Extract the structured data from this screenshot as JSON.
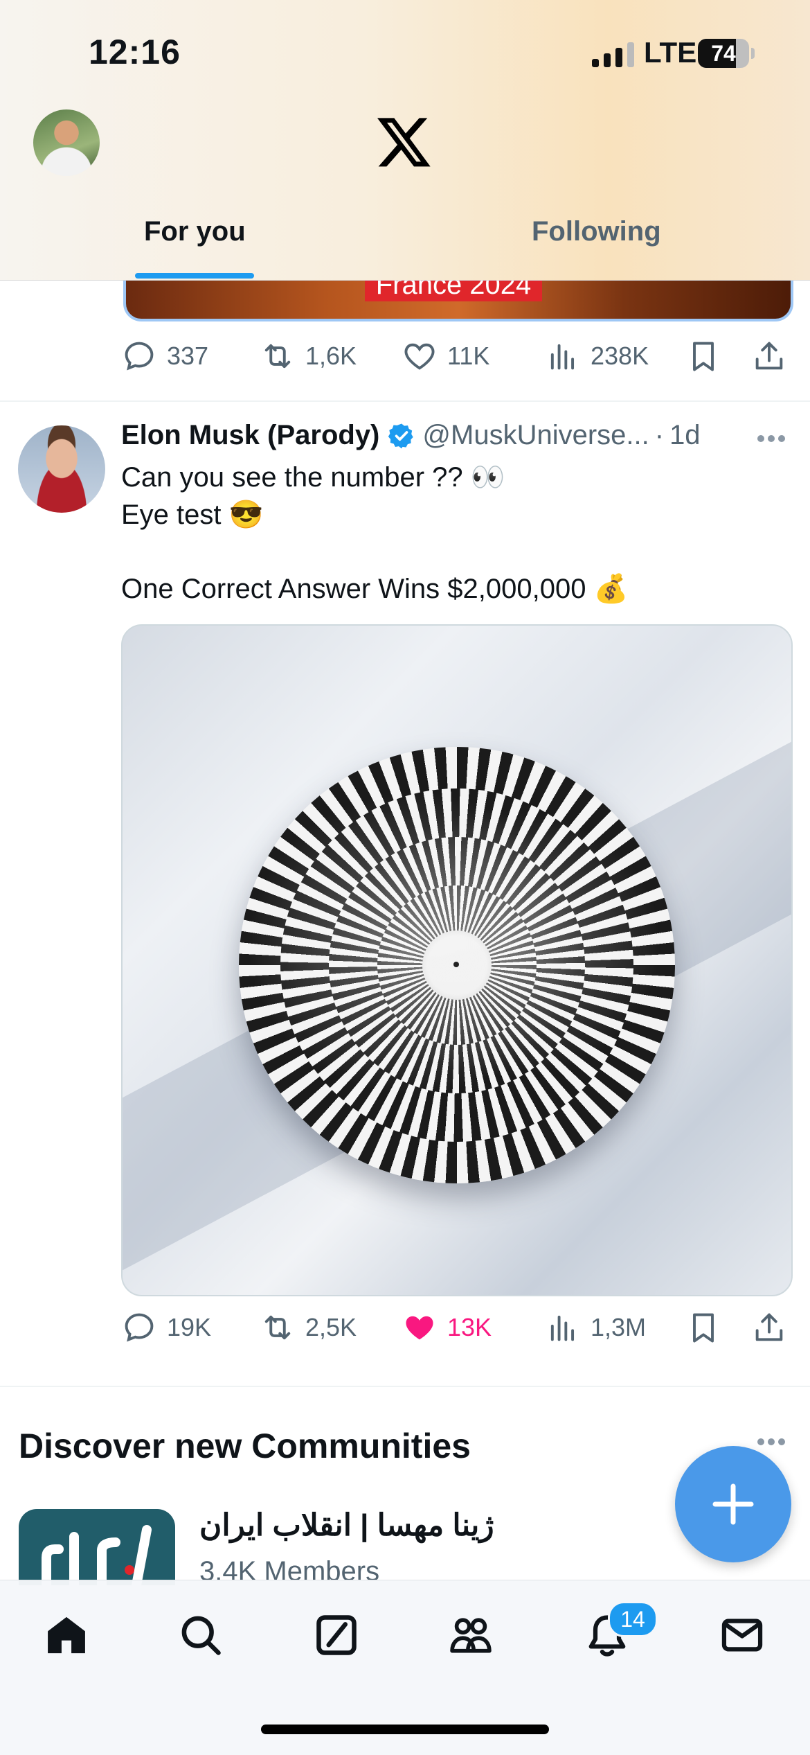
{
  "status_bar": {
    "time": "12:16",
    "network": "LTE",
    "battery": "74",
    "battery_level": 0.74
  },
  "header": {
    "logo": "x-logo-icon",
    "tabs": [
      {
        "label": "For you",
        "active": true
      },
      {
        "label": "Following",
        "active": false
      }
    ]
  },
  "prev_tweet": {
    "media_caption": "France 2024",
    "actions": {
      "replies": "337",
      "reposts": "1,6K",
      "likes": "11K",
      "views": "238K"
    }
  },
  "tweet": {
    "name": "Elon Musk (Parody)",
    "handle": "@MuskUniverse...",
    "separator": "·",
    "time": "1d",
    "text_lines": [
      "Can you see the number ?? 👀",
      "Eye test 😎",
      "One Correct Answer Wins $2,000,000 💰"
    ],
    "actions": {
      "replies": "19K",
      "reposts": "2,5K",
      "likes": "13K",
      "views": "1,3M",
      "liked": true
    }
  },
  "discover": {
    "title": "Discover new Communities",
    "community": {
      "name": "ژینا مهسا | انقلاب ایران",
      "members": "3.4K Members",
      "thumb_text": "آزادی"
    }
  },
  "compose_button": {
    "icon": "plus-icon"
  },
  "bottom_nav": {
    "items": [
      "home-icon",
      "search-icon",
      "grok-icon",
      "communities-icon",
      "notifications-icon",
      "messages-icon"
    ],
    "notification_count": "14"
  },
  "colors": {
    "accent": "#1d9bf0",
    "like": "#f91880",
    "muted": "#536471"
  }
}
